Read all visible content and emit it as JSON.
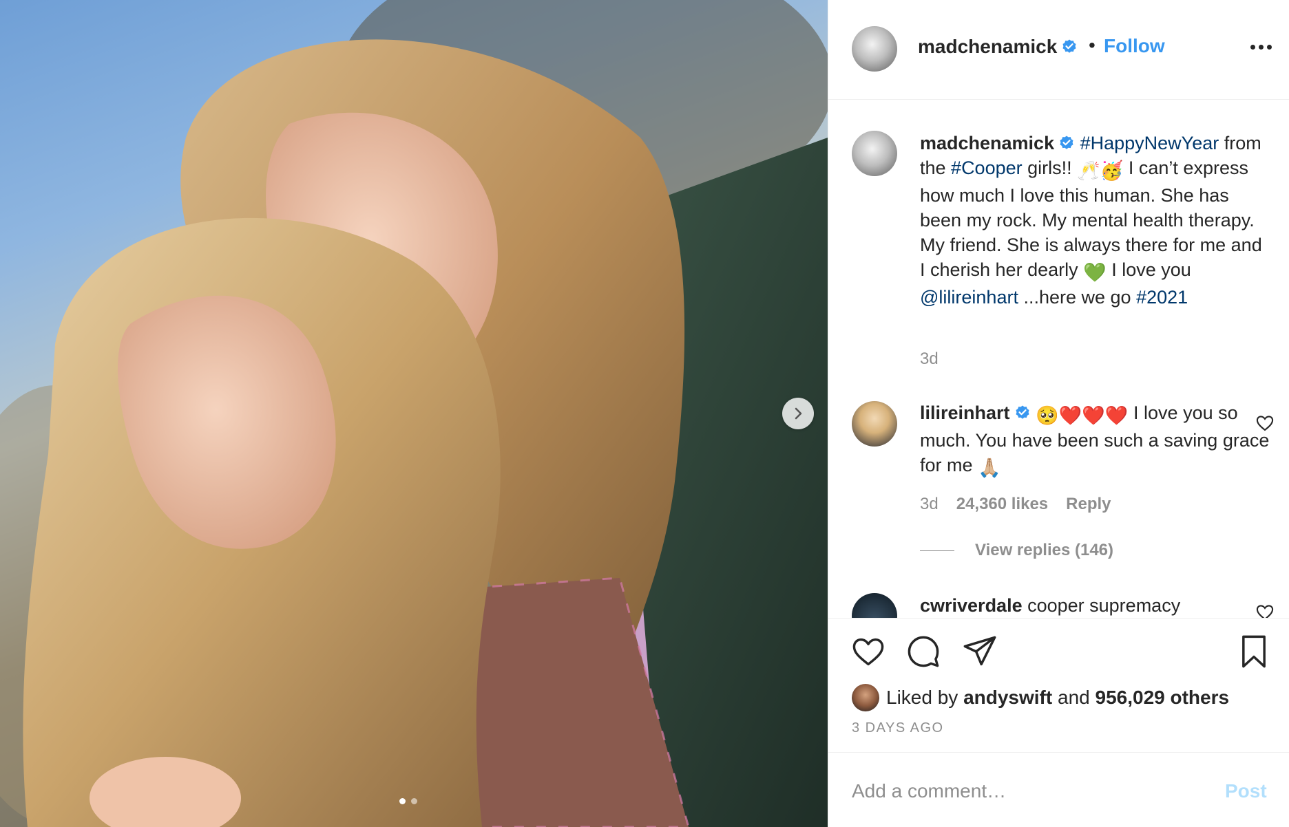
{
  "post": {
    "author": "madchenamick",
    "follow_label": "Follow",
    "separator": "•",
    "images_count": 2,
    "active_image": 1
  },
  "caption": {
    "username": "madchenamick",
    "hashtag_1": "#HappyNewYear",
    "part_1": "from the ",
    "hashtag_2": "#Cooper",
    "part_2": " girls!! ",
    "emoji_1": "🥂🥳",
    "part_3": " I can’t express how much I love this human. She has been my rock. My mental health therapy. My friend. She is always there for me and I cherish her dearly ",
    "emoji_2": "💚",
    "part_4": " I love you ",
    "mention": "@lilireinhart",
    "part_5": " ...here we go ",
    "hashtag_3": "#2021",
    "time": "3d"
  },
  "comment_1": {
    "username": "lilireinhart",
    "emoji_1": "🥺❤️❤️❤️",
    "text": " I love you so much. You have been such a saving grace for me ",
    "emoji_2": "🙏🏼",
    "time": "3d",
    "likes": "24,360 likes",
    "reply_label": "Reply",
    "view_replies": "View replies (146)"
  },
  "comment_2": {
    "username": "cwriverdale",
    "text": " cooper supremacy"
  },
  "actions": {
    "liked_prefix": "Liked by ",
    "liked_user": "andyswift",
    "liked_and": " and ",
    "liked_others": "956,029 others",
    "timestamp": "3 DAYS AGO"
  },
  "add_comment": {
    "placeholder": "Add a comment…",
    "post_label": "Post"
  },
  "colors": {
    "link_blue": "#3897f0",
    "hashtag_blue": "#00376b",
    "muted_gray": "#8e8e8e",
    "post_disabled": "#b2dffc"
  },
  "icons": [
    "verified-badge-icon",
    "more-icon",
    "heart-icon",
    "comment-icon",
    "share-icon",
    "bookmark-icon",
    "chevron-right-icon"
  ]
}
